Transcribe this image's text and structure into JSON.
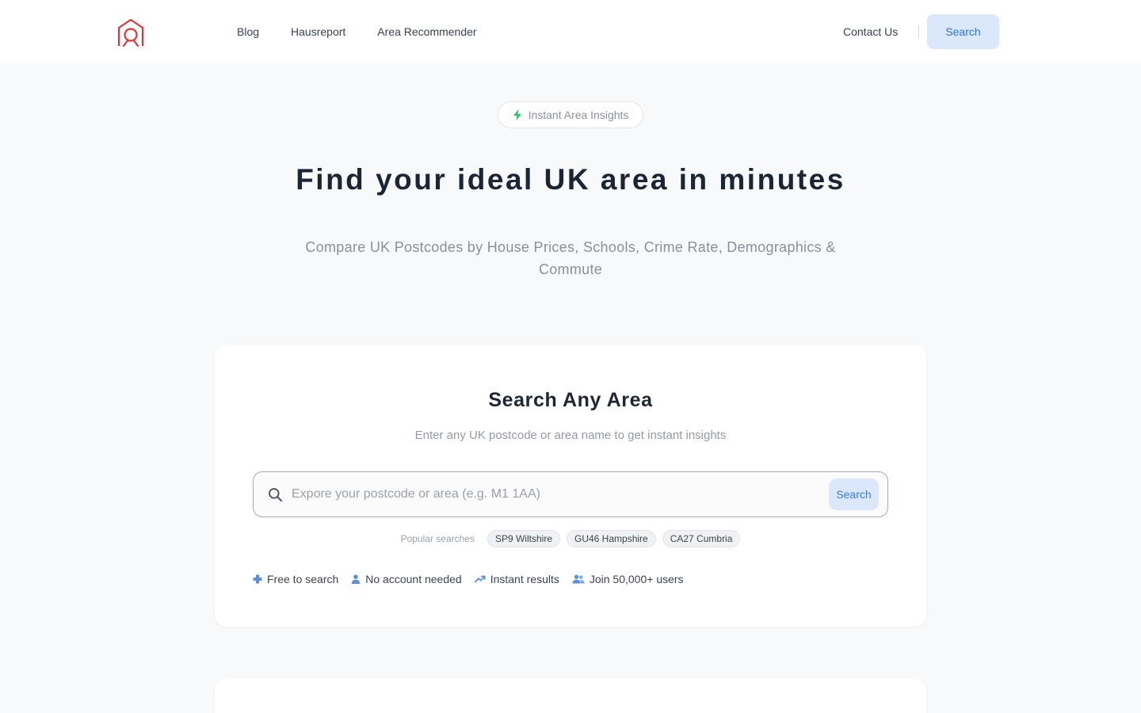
{
  "colors": {
    "brand": "#d9383a",
    "accent": "#2d73d3",
    "accent_bg": "#dbe8fb",
    "bolt": "#22c55e",
    "background": "#f8f9fb"
  },
  "header": {
    "logo_icon": "house-pin-logo-icon",
    "nav": [
      "Blog",
      "Hausreport",
      "Area Recommender"
    ],
    "contact_label": "Contact Us",
    "search_label": "Search"
  },
  "hero": {
    "badge_icon": "bolt-icon",
    "badge_label": "Instant Area Insights",
    "title": "Find your ideal UK area in minutes",
    "subtitle": "Compare UK Postcodes by House Prices, Schools, Crime Rate, Demographics & Commute"
  },
  "search_card": {
    "title": "Search Any Area",
    "subtitle": "Enter any UK postcode or area name to get instant insights",
    "input_value": "",
    "input_placeholder": "Expore your postcode or area (e.g. M1 1AA)",
    "search_button_label": "Search",
    "popular_label": "Popular searches",
    "popular": [
      "SP9 Wiltshire",
      "GU46 Hampshire",
      "CA27 Cumbria"
    ],
    "features": [
      {
        "icon": "plus-icon",
        "label": "Free to search"
      },
      {
        "icon": "user-icon",
        "label": "No account needed"
      },
      {
        "icon": "trending-up-icon",
        "label": "Instant results"
      },
      {
        "icon": "users-icon",
        "label": "Join 50,000+ users"
      }
    ]
  }
}
